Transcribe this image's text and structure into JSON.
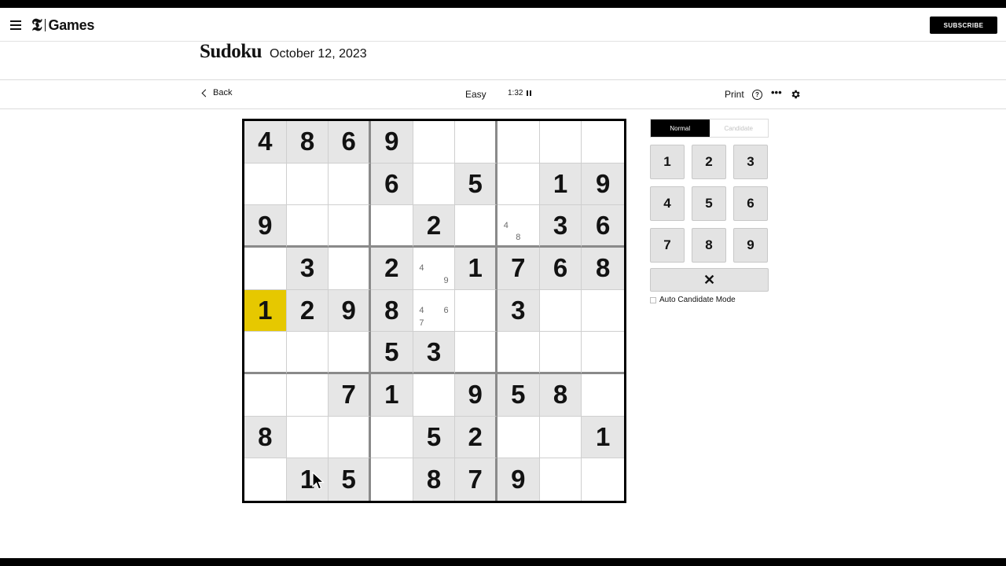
{
  "nav": {
    "brand_mark": "𝕿",
    "brand_word": "Games",
    "subscribe_label": "SUBSCRIBE"
  },
  "header": {
    "title": "Sudoku",
    "date": "October 12, 2023"
  },
  "toolbar": {
    "back_label": "Back",
    "difficulty": "Easy",
    "timer": "1:32",
    "print_label": "Print",
    "help_glyph": "?",
    "more_glyph": "•••"
  },
  "board": {
    "selected": [
      4,
      0
    ],
    "rows": [
      [
        "4",
        "8",
        "6",
        "9",
        "",
        "",
        "",
        "",
        ""
      ],
      [
        "",
        "",
        "",
        "6",
        "",
        "5",
        "",
        "1",
        "9"
      ],
      [
        "9",
        "",
        "",
        "",
        "2",
        "",
        "",
        "3",
        "6"
      ],
      [
        "",
        "3",
        "",
        "2",
        "",
        "1",
        "7",
        "6",
        "8"
      ],
      [
        "1",
        "2",
        "9",
        "8",
        "",
        "",
        "3",
        "",
        ""
      ],
      [
        "",
        "",
        "",
        "5",
        "3",
        "",
        "",
        "",
        ""
      ],
      [
        "",
        "",
        "7",
        "1",
        "",
        "9",
        "5",
        "8",
        ""
      ],
      [
        "8",
        "",
        "",
        "",
        "5",
        "2",
        "",
        "",
        "1"
      ],
      [
        "",
        "1",
        "5",
        "",
        "8",
        "7",
        "9",
        "",
        ""
      ]
    ],
    "candidates": [
      {
        "row": 2,
        "col": 6,
        "notes": [
          "",
          "",
          "",
          "4",
          "",
          "",
          "",
          "8",
          ""
        ]
      },
      {
        "row": 3,
        "col": 4,
        "notes": [
          "",
          "",
          "",
          "4",
          "",
          "",
          "",
          "",
          "9"
        ]
      },
      {
        "row": 4,
        "col": 4,
        "notes": [
          "",
          "",
          "",
          "4",
          "",
          "6",
          "7",
          "",
          ""
        ]
      }
    ]
  },
  "panel": {
    "mode_normal": "Normal",
    "mode_candidate": "Candidate",
    "keys": [
      "1",
      "2",
      "3",
      "4",
      "5",
      "6",
      "7",
      "8",
      "9"
    ],
    "erase_glyph": "✕",
    "auto_candidate_label": "Auto Candidate Mode"
  },
  "colors": {
    "selected_cell": "#e6c800",
    "given_cell": "#e6e6e6",
    "accent": "#000000"
  }
}
